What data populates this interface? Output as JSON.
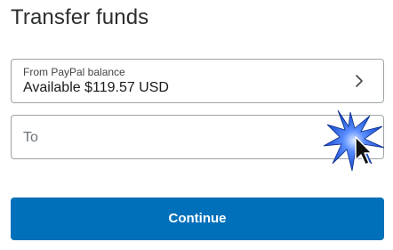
{
  "page": {
    "title": "Transfer funds"
  },
  "from_field": {
    "label": "From PayPal balance",
    "value": "Available $119.57 USD"
  },
  "to_field": {
    "placeholder": "To"
  },
  "actions": {
    "continue_label": "Continue"
  },
  "colors": {
    "primary": "#0070ba",
    "border": "#9da3a6",
    "text": "#2c2e2f"
  },
  "icons": {
    "from_chevron": "chevron-right-icon",
    "cursor": "mouse-pointer-icon"
  }
}
